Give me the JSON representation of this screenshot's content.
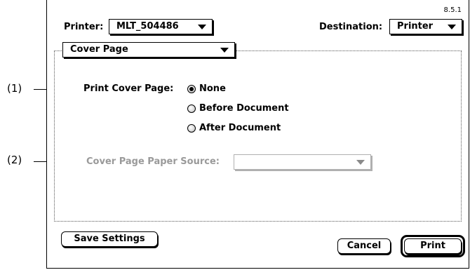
{
  "version": "8.5.1",
  "printer": {
    "label": "Printer:",
    "value": "MLT_504486"
  },
  "destination": {
    "label": "Destination:",
    "value": "Printer"
  },
  "panel": {
    "value": "Cover Page"
  },
  "cover_page": {
    "label": "Print Cover Page:",
    "options": [
      "None",
      "Before Document",
      "After Document"
    ],
    "selected": "None"
  },
  "paper_source": {
    "label": "Cover Page Paper Source:",
    "value": ""
  },
  "buttons": {
    "save": "Save Settings",
    "cancel": "Cancel",
    "print": "Print"
  },
  "callouts": {
    "c1": "(1)",
    "c2": "(2)"
  },
  "colors": {
    "disabled_text": "#9a9a9a"
  }
}
